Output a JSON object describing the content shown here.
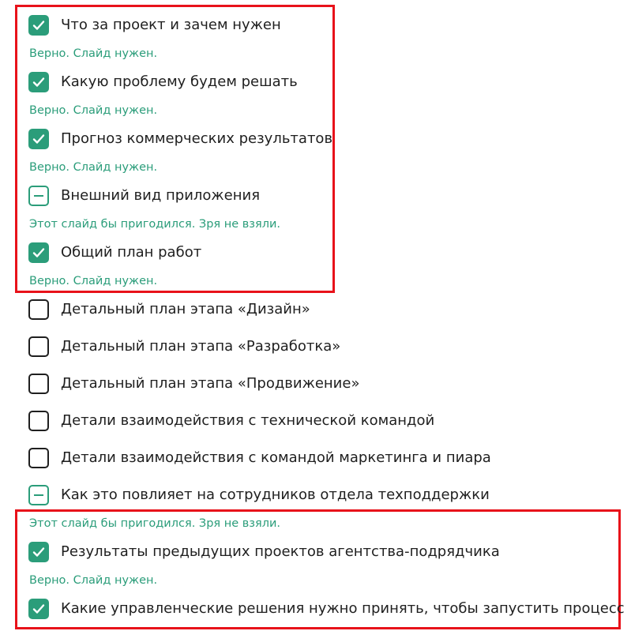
{
  "colors": {
    "accent": "#2b9d7a",
    "highlight": "#e8121a",
    "text": "#1f1f1f"
  },
  "items": [
    {
      "label": "Что за проект и зачем нужен",
      "state": "checked",
      "feedback": "Верно. Слайд нужен."
    },
    {
      "label": "Какую проблему будем решать",
      "state": "checked",
      "feedback": "Верно. Слайд нужен."
    },
    {
      "label": "Прогноз коммерческих результатов",
      "state": "checked",
      "feedback": "Верно. Слайд нужен."
    },
    {
      "label": "Внешний вид приложения",
      "state": "dash",
      "feedback": "Этот слайд бы пригодился. Зря не взяли."
    },
    {
      "label": "Общий план работ",
      "state": "checked",
      "feedback": "Верно. Слайд нужен."
    },
    {
      "label": "Детальный план этапа «Дизайн»",
      "state": "unchecked"
    },
    {
      "label": "Детальный план этапа «Разработка»",
      "state": "unchecked"
    },
    {
      "label": "Детальный план этапа «Продвижение»",
      "state": "unchecked"
    },
    {
      "label": "Детали взаимодействия с технической командой",
      "state": "unchecked"
    },
    {
      "label": "Детали взаимодействия с командой маркетинга и пиара",
      "state": "unchecked"
    },
    {
      "label": "Как это повлияет на сотрудников отдела техподдержки",
      "state": "dash",
      "feedback": "Этот слайд бы пригодился. Зря не взяли."
    },
    {
      "label": "Результаты предыдущих проектов агентства-подрядчика",
      "state": "checked",
      "feedback": "Верно. Слайд нужен."
    },
    {
      "label": "Какие управленческие решения нужно принять, чтобы запустить процесс",
      "state": "checked"
    }
  ]
}
